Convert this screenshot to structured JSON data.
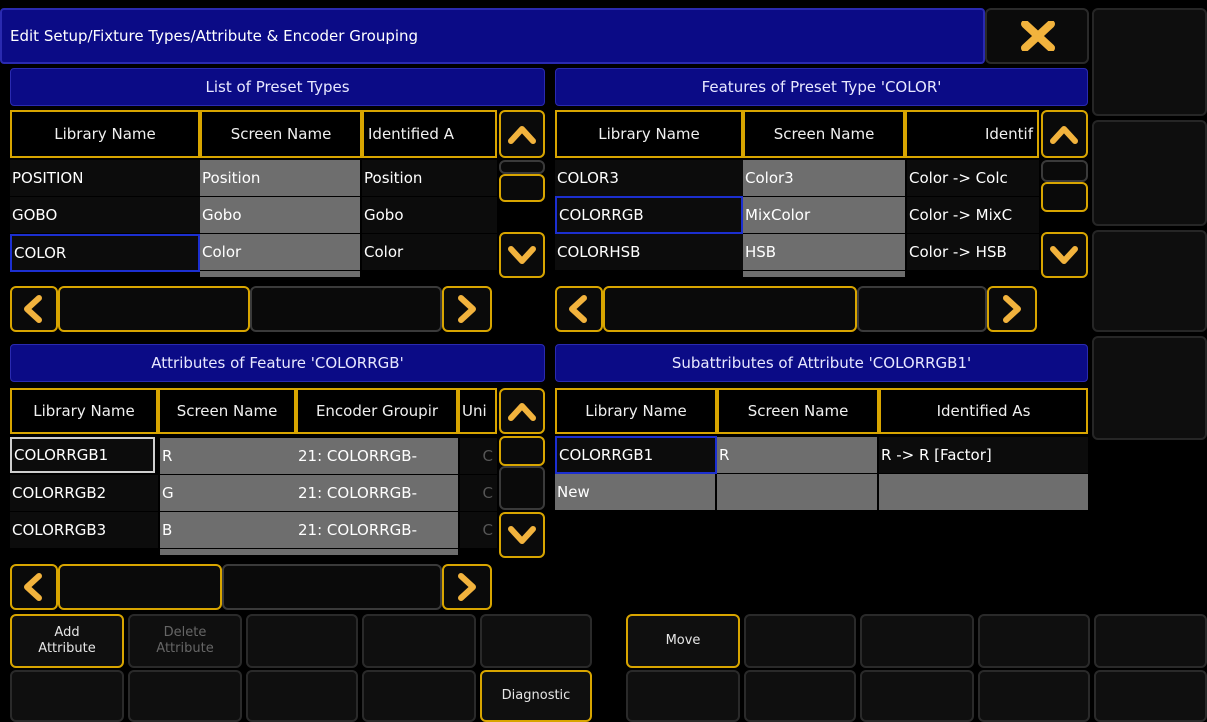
{
  "window": {
    "title": "Edit Setup/Fixture Types/Attribute & Encoder Grouping"
  },
  "preset_types": {
    "header": "List of Preset Types",
    "columns": [
      "Library Name",
      "Screen Name",
      "Identified A"
    ],
    "rows": [
      [
        "POSITION",
        "Position",
        "Position"
      ],
      [
        "GOBO",
        "Gobo",
        "Gobo"
      ],
      [
        "COLOR",
        "Color",
        "Color"
      ]
    ]
  },
  "features": {
    "header": "Features of Preset Type 'COLOR'",
    "columns": [
      "Library Name",
      "Screen Name",
      "Identif"
    ],
    "rows": [
      [
        "COLOR3",
        "Color3",
        "Color -> Colc"
      ],
      [
        "COLORRGB",
        "MixColor",
        "Color -> MixC"
      ],
      [
        "COLORHSB",
        "HSB",
        "Color -> HSB"
      ]
    ]
  },
  "attributes": {
    "header": "Attributes of Feature 'COLORRGB'",
    "columns": [
      "Library Name",
      "Screen Name",
      "Encoder Groupir",
      "Uni"
    ],
    "rows": [
      [
        "COLORRGB1",
        "R",
        "21: COLORRGB-",
        "C"
      ],
      [
        "COLORRGB2",
        "G",
        "21: COLORRGB-",
        "C"
      ],
      [
        "COLORRGB3",
        "B",
        "21: COLORRGB-",
        "C"
      ]
    ]
  },
  "subattributes": {
    "header": "Subattributes of Attribute 'COLORRGB1'",
    "columns": [
      "Library Name",
      "Screen Name",
      "Identified As"
    ],
    "rows": [
      [
        "COLORRGB1",
        "R",
        "R -> R [Factor]"
      ],
      [
        "New",
        "",
        ""
      ]
    ]
  },
  "buttons": {
    "add_attribute": "Add\nAttribute",
    "delete_attribute": "Delete\nAttribute",
    "move": "Move",
    "diagnostic": "Diagnostic"
  },
  "colors": {
    "panel_blue": "#0b0b86",
    "accent_yellow": "#d8a500",
    "cell_gray": "#6e6e6e",
    "close_orange": "#f2b33d"
  }
}
